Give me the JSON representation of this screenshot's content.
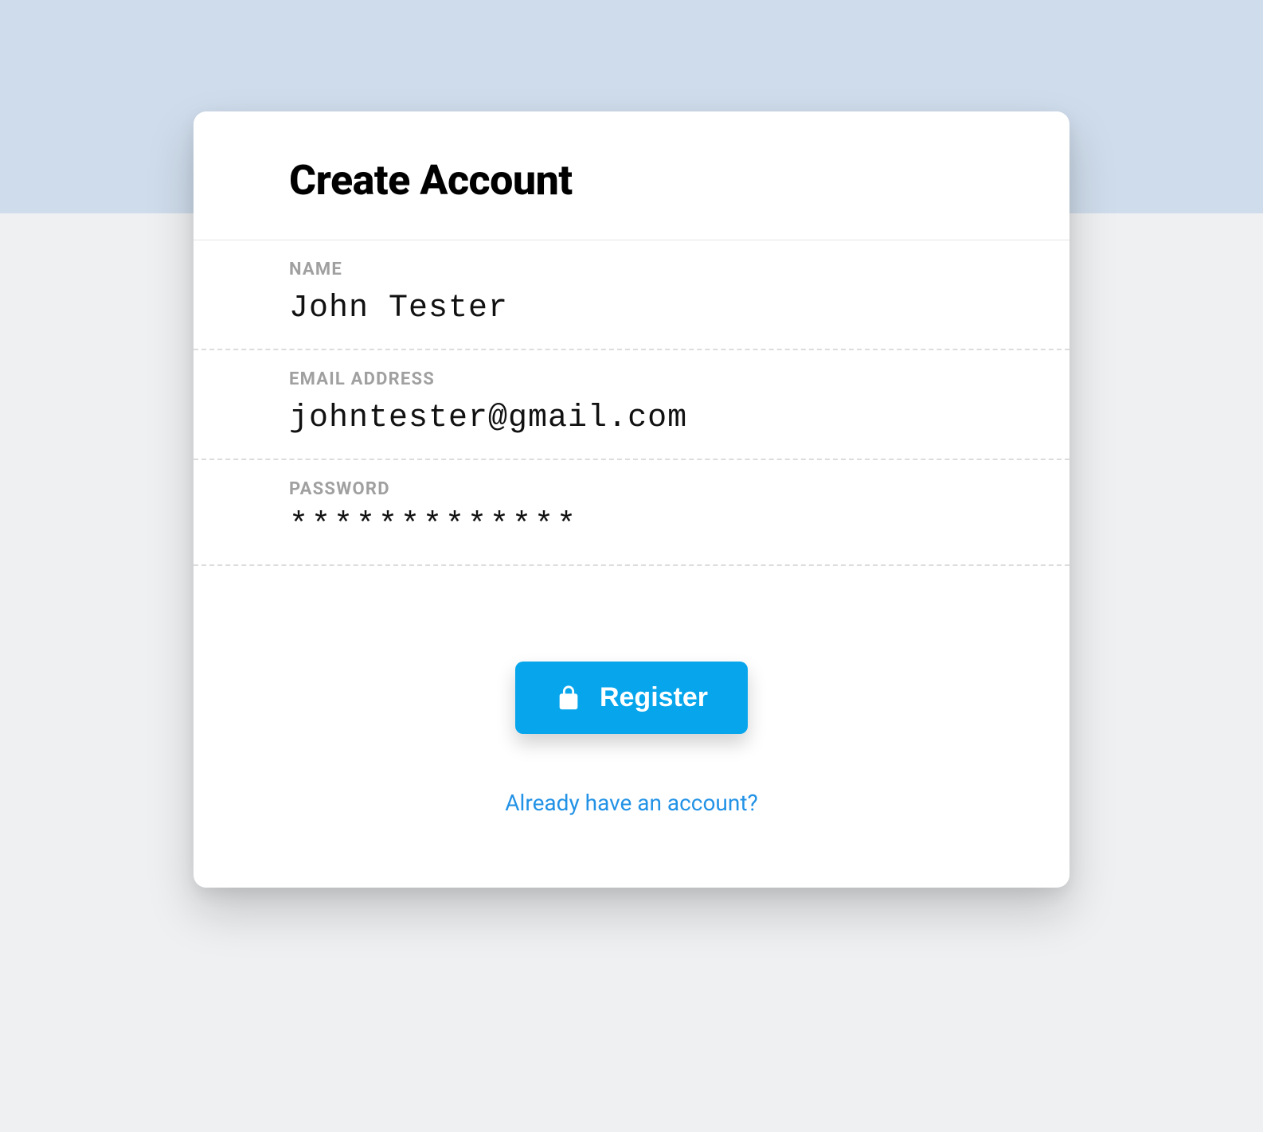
{
  "header": {
    "title": "Create Account"
  },
  "fields": {
    "name": {
      "label": "NAME",
      "value": "John Tester"
    },
    "email": {
      "label": "EMAIL ADDRESS",
      "value": "johntester@gmail.com"
    },
    "password": {
      "label": "PASSWORD",
      "masked_value": "*************"
    }
  },
  "actions": {
    "register_label": "Register",
    "already_account_label": "Already have an account?"
  },
  "colors": {
    "top_band": "#cfdceb",
    "background": "#eef0f2",
    "primary": "#07a6ec",
    "link": "#2292e6"
  }
}
